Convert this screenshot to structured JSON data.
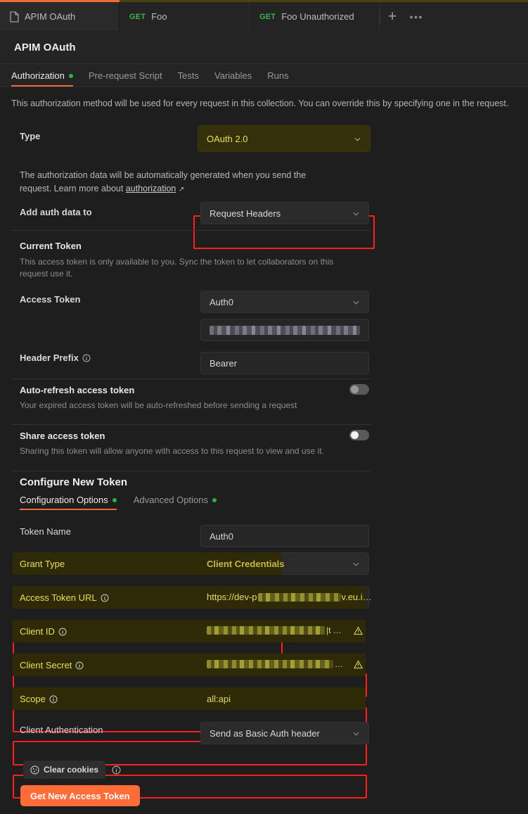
{
  "window": {
    "tabs": [
      {
        "name": "APIM OAuth",
        "icon": "document-icon",
        "active": true
      },
      {
        "method": "GET",
        "name": "Foo",
        "active": false
      },
      {
        "method": "GET",
        "name": "Foo Unauthorized",
        "active": false
      }
    ],
    "new_tab_icon": "plus-icon",
    "more_tabs_icon": "ellipsis-icon"
  },
  "collection": {
    "title": "APIM OAuth"
  },
  "section_tabs": [
    {
      "label": "Authorization",
      "dot": true,
      "active": true
    },
    {
      "label": "Pre-request Script",
      "dot": false,
      "active": false
    },
    {
      "label": "Tests",
      "dot": false,
      "active": false
    },
    {
      "label": "Variables",
      "dot": false,
      "active": false
    },
    {
      "label": "Runs",
      "dot": false,
      "active": false
    }
  ],
  "note": "This authorization method will be used for every request in this collection. You can override this by specifying one in the request.",
  "type_row": {
    "label": "Type",
    "value": "OAuth 2.0",
    "highlighted": true
  },
  "help": {
    "line1": "The authorization data will be automatically generated when you send the",
    "line2_pre": "request. Learn more about ",
    "link": "authorization",
    "link_icon": "external-link-icon"
  },
  "add_auth_row": {
    "label": "Add auth data to",
    "value": "Request Headers"
  },
  "current_token": {
    "heading": "Current Token",
    "description": "This access token is only available to you. Sync the token to let collaborators on this request use it.",
    "access_token_label": "Access Token",
    "access_token_value": "Auth0",
    "access_token_secret_value": "",
    "header_prefix_label": "Header Prefix",
    "header_prefix_value": "Bearer",
    "header_prefix_info_icon": "info-icon"
  },
  "auto_refresh": {
    "label": "Auto-refresh access token",
    "description": "Your expired access token will be auto-refreshed before sending a request",
    "enabled": false
  },
  "share_token": {
    "label": "Share access token",
    "description": "Sharing this token will allow anyone with access to this request to view and use it.",
    "enabled": false
  },
  "configure_new_token": {
    "heading": "Configure New Token",
    "tabs": [
      {
        "label": "Configuration Options",
        "dot": true,
        "active": true
      },
      {
        "label": "Advanced Options",
        "dot": true,
        "active": false
      }
    ],
    "fields": [
      {
        "label": "Token Name",
        "value": "Auth0",
        "type": "input",
        "info": false,
        "highlighted": false,
        "warn": false
      },
      {
        "label": "Grant Type",
        "value": "Client Credentials",
        "type": "select",
        "info": false,
        "highlighted": true,
        "warn": false
      },
      {
        "label": "Access Token URL",
        "value": "https://dev-p",
        "value_suffix": "v.eu.i…",
        "type": "input",
        "info": true,
        "highlighted": true,
        "warn": false,
        "masked": true
      },
      {
        "label": "Client ID",
        "value": "",
        "value_suffix": "|t …",
        "type": "input",
        "info": true,
        "highlighted": true,
        "warn": true,
        "masked": true
      },
      {
        "label": "Client Secret",
        "value": "",
        "value_suffix": "…",
        "type": "input",
        "info": true,
        "highlighted": true,
        "warn": true,
        "masked": true
      },
      {
        "label": "Scope",
        "value": "all:api",
        "type": "input",
        "info": true,
        "highlighted": true,
        "warn": false
      },
      {
        "label": "Client Authentication",
        "value": "Send as Basic Auth header",
        "type": "select",
        "info": false,
        "highlighted": false,
        "warn": false
      }
    ]
  },
  "actions": {
    "clear_cookies_label": "Clear cookies",
    "clear_cookies_icon": "cookie-icon",
    "clear_cookies_info_icon": "info-icon",
    "get_token_label": "Get New Access Token"
  },
  "colors": {
    "accent": "#ff6c37",
    "highlight_border": "#ff1d1d",
    "highlight_fill": "#34300c",
    "highlight_text": "#e8e14a",
    "method_get": "#3bb54a",
    "status_dot": "#29b34a",
    "background": "#1e1e1e",
    "panel": "#242424"
  }
}
